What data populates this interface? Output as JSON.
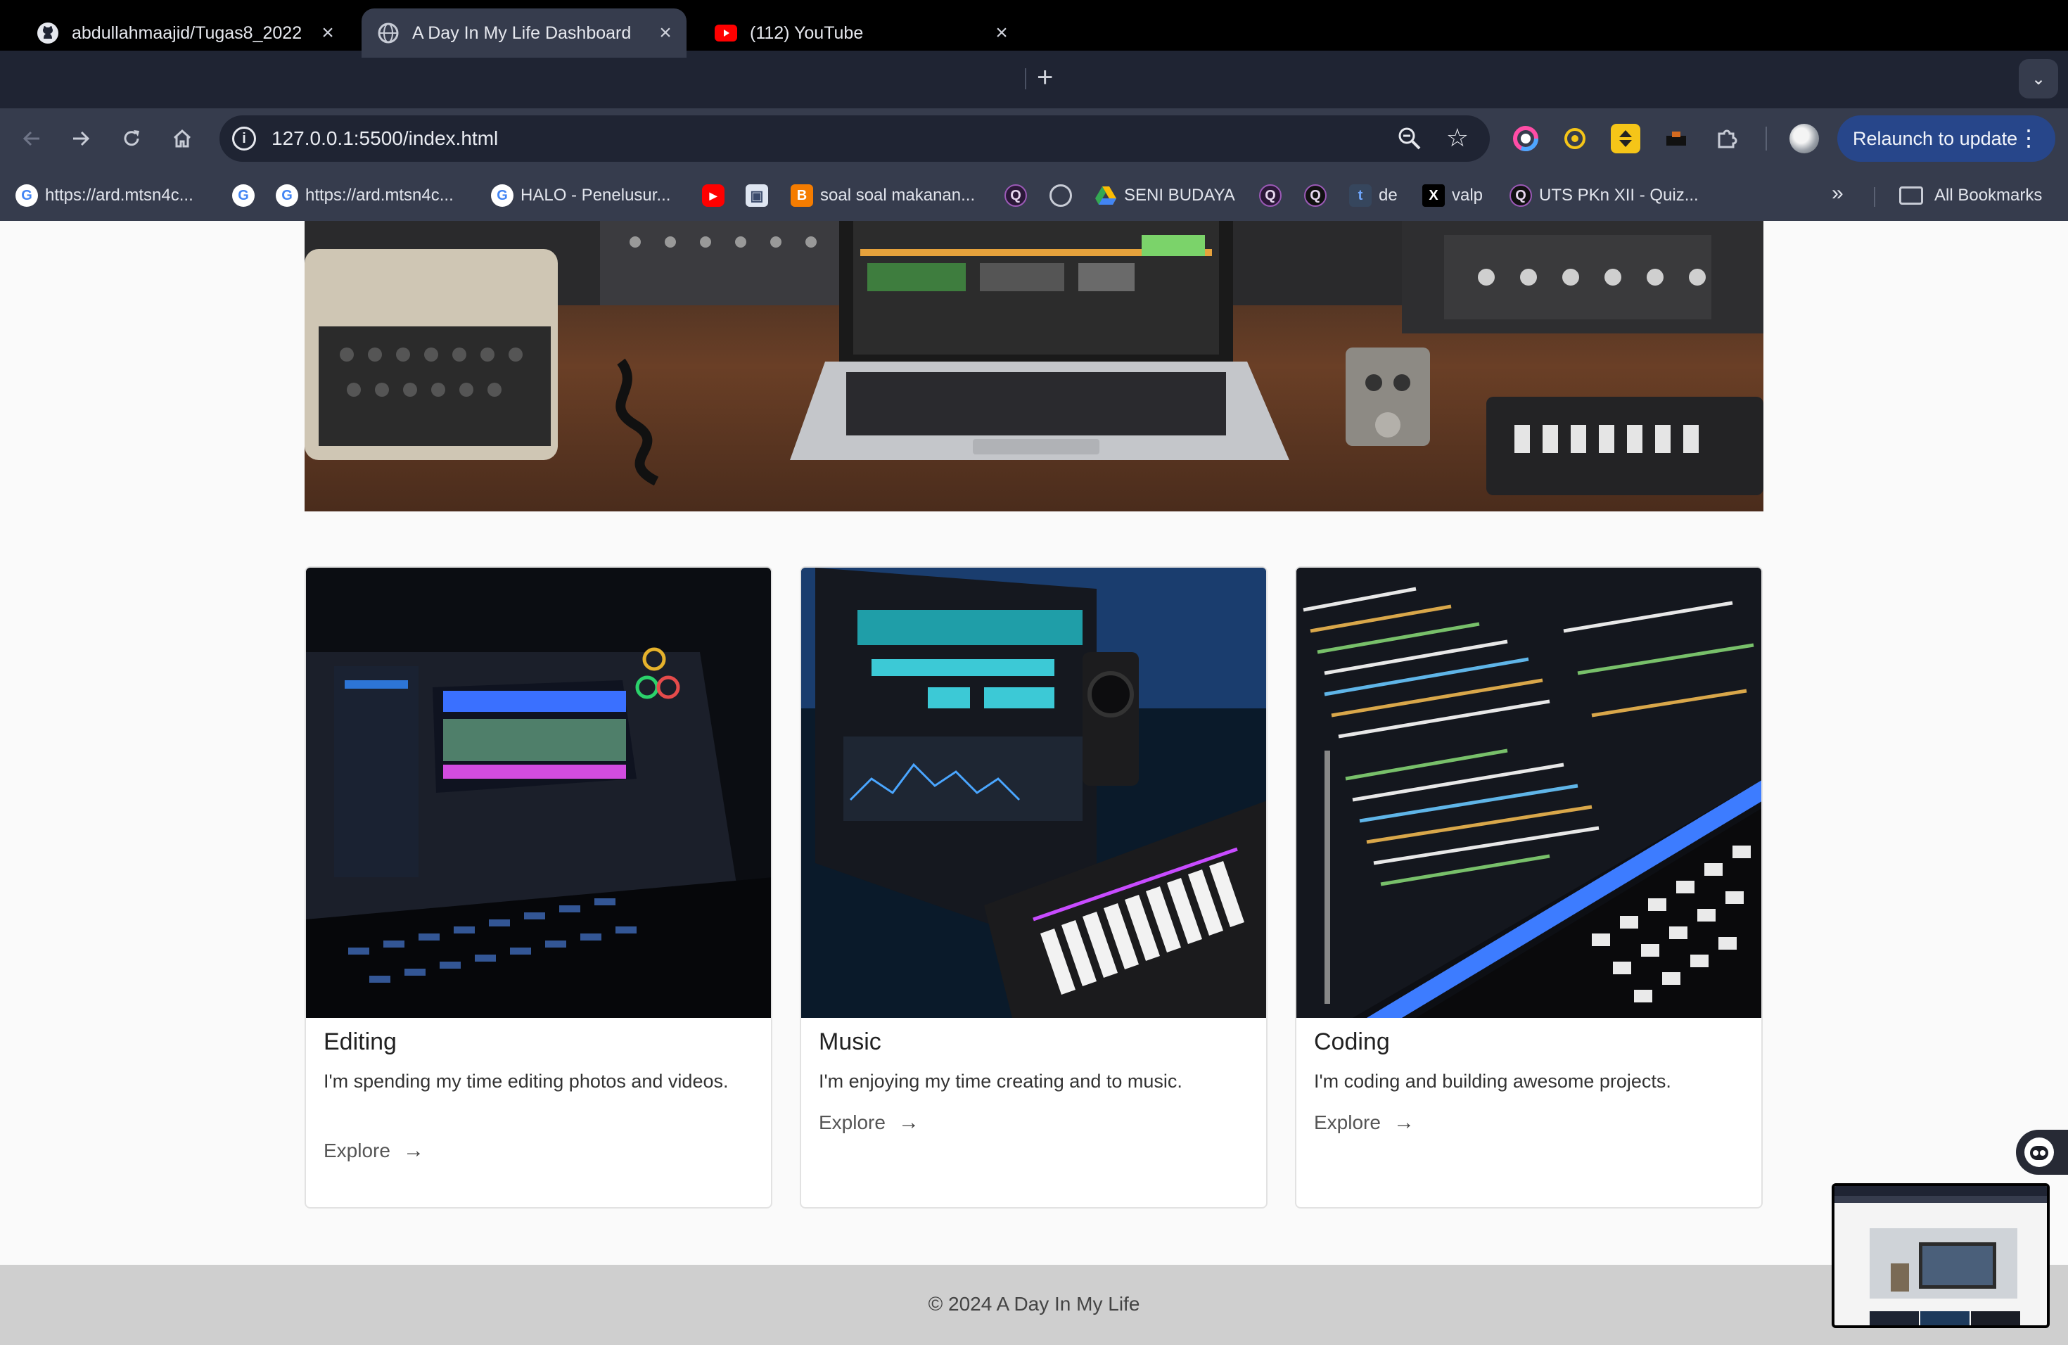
{
  "browser": {
    "tabs": [
      {
        "title": "abdullahmaajid/Tugas8_2022",
        "icon": "github-icon",
        "active": false
      },
      {
        "title": "A Day In My Life Dashboard",
        "icon": "globe-icon",
        "active": true
      },
      {
        "title": "(112) YouTube",
        "icon": "youtube-icon",
        "active": false
      }
    ],
    "new_tab": "+",
    "url": "127.0.0.1:5500/index.html",
    "relaunch_label": "Relaunch to update",
    "bookmarks": [
      {
        "label": "https://ard.mtsn4c...",
        "icon": "google-icon"
      },
      {
        "label": "",
        "icon": "google-icon"
      },
      {
        "label": "https://ard.mtsn4c...",
        "icon": "google-icon"
      },
      {
        "label": "HALO - Penelusur...",
        "icon": "google-icon"
      },
      {
        "label": "",
        "icon": "youtube-icon"
      },
      {
        "label": "",
        "icon": "app-icon"
      },
      {
        "label": "soal soal makanan...",
        "icon": "blogger-icon"
      },
      {
        "label": "",
        "icon": "quizizz-icon"
      },
      {
        "label": "",
        "icon": "globe-icon"
      },
      {
        "label": "SENI BUDAYA",
        "icon": "drive-icon"
      },
      {
        "label": "",
        "icon": "quizizz-icon"
      },
      {
        "label": "",
        "icon": "quizizz-icon"
      },
      {
        "label": "de",
        "icon": "tumblr-icon"
      },
      {
        "label": "valp",
        "icon": "x-icon"
      },
      {
        "label": "UTS PKn XII - Quiz...",
        "icon": "quizizz-icon"
      }
    ],
    "all_bookmarks": "All Bookmarks"
  },
  "cards": [
    {
      "title": "Editing",
      "text": "I'm spending my time editing photos and videos.",
      "link": "Explore",
      "arrow": "→"
    },
    {
      "title": "Music",
      "text": "I'm enjoying my time creating and to music.",
      "link": "Explore",
      "arrow": "→"
    },
    {
      "title": "Coding",
      "text": "I'm coding and building awesome projects.",
      "link": "Explore",
      "arrow": "→"
    }
  ],
  "footer": {
    "text": "© 2024 A Day In My Life"
  },
  "colors": {
    "tabbar": "#1f2433",
    "toolbar": "#363c4d",
    "relaunch": "#27468a",
    "footer": "#cfcfcf"
  }
}
